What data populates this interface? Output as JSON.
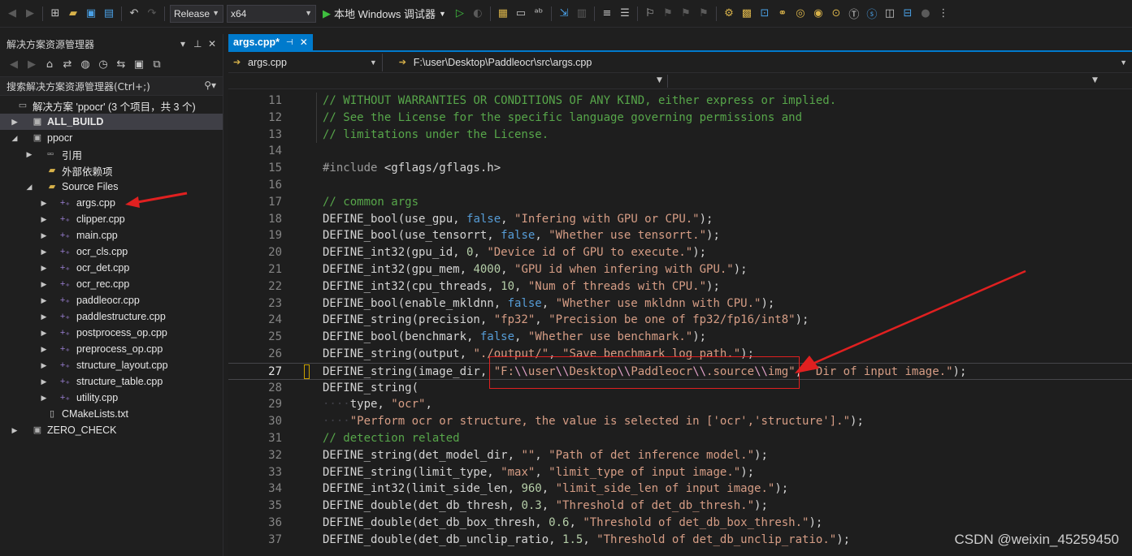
{
  "toolbar": {
    "configuration": "Release",
    "platform": "x64",
    "run_label": "本地 Windows 调试器"
  },
  "explorer": {
    "title": "解决方案资源管理器",
    "search_placeholder": "搜索解决方案资源管理器(Ctrl+;)",
    "items": [
      {
        "label": "解决方案 'ppocr' (3 个项目，共 3 个)",
        "icon": "solution-icon"
      },
      {
        "label": "ALL_BUILD",
        "icon": "project-icon"
      },
      {
        "label": "ppocr",
        "icon": "project-icon"
      },
      {
        "label": "引用",
        "icon": "references-icon"
      },
      {
        "label": "外部依赖项",
        "icon": "folder-icon"
      },
      {
        "label": "Source Files",
        "icon": "folder-icon"
      },
      {
        "label": "args.cpp",
        "icon": "cpp-file-icon"
      },
      {
        "label": "clipper.cpp",
        "icon": "cpp-file-icon"
      },
      {
        "label": "main.cpp",
        "icon": "cpp-file-icon"
      },
      {
        "label": "ocr_cls.cpp",
        "icon": "cpp-file-icon"
      },
      {
        "label": "ocr_det.cpp",
        "icon": "cpp-file-icon"
      },
      {
        "label": "ocr_rec.cpp",
        "icon": "cpp-file-icon"
      },
      {
        "label": "paddleocr.cpp",
        "icon": "cpp-file-icon"
      },
      {
        "label": "paddlestructure.cpp",
        "icon": "cpp-file-icon"
      },
      {
        "label": "postprocess_op.cpp",
        "icon": "cpp-file-icon"
      },
      {
        "label": "preprocess_op.cpp",
        "icon": "cpp-file-icon"
      },
      {
        "label": "structure_layout.cpp",
        "icon": "cpp-file-icon"
      },
      {
        "label": "structure_table.cpp",
        "icon": "cpp-file-icon"
      },
      {
        "label": "utility.cpp",
        "icon": "cpp-file-icon"
      },
      {
        "label": "CMakeLists.txt",
        "icon": "text-file-icon"
      },
      {
        "label": "ZERO_CHECK",
        "icon": "project-icon"
      }
    ]
  },
  "editor": {
    "tab_label": "args.cpp*",
    "nav_file": "args.cpp",
    "nav_path": "F:\\user\\Desktop\\Paddleocr\\src\\args.cpp",
    "current_line": "27",
    "lines": [
      {
        "n": "11",
        "tokens": [
          [
            "c-cm",
            "// WITHOUT WARRANTIES OR CONDITIONS OF ANY KIND, either express or implied."
          ]
        ]
      },
      {
        "n": "12",
        "tokens": [
          [
            "c-cm",
            "// See the License for the specific language governing permissions and"
          ]
        ]
      },
      {
        "n": "13",
        "tokens": [
          [
            "c-cm",
            "// limitations under the License."
          ]
        ]
      },
      {
        "n": "14",
        "tokens": []
      },
      {
        "n": "15",
        "tokens": [
          [
            "c-pp",
            "#include "
          ],
          [
            "",
            "<gflags/gflags.h>"
          ]
        ]
      },
      {
        "n": "16",
        "tokens": []
      },
      {
        "n": "17",
        "tokens": [
          [
            "c-cm",
            "// common args"
          ]
        ]
      },
      {
        "n": "18",
        "tokens": [
          [
            "",
            "DEFINE_bool(use_gpu, "
          ],
          [
            "c-kw",
            "false"
          ],
          [
            "",
            ", "
          ],
          [
            "c-st",
            "\"Infering with GPU or CPU.\""
          ],
          [
            "",
            ");"
          ]
        ]
      },
      {
        "n": "19",
        "tokens": [
          [
            "",
            "DEFINE_bool(use_tensorrt, "
          ],
          [
            "c-kw",
            "false"
          ],
          [
            "",
            ", "
          ],
          [
            "c-st",
            "\"Whether use tensorrt.\""
          ],
          [
            "",
            ");"
          ]
        ]
      },
      {
        "n": "20",
        "tokens": [
          [
            "",
            "DEFINE_int32(gpu_id, "
          ],
          [
            "c-nm",
            "0"
          ],
          [
            "",
            ", "
          ],
          [
            "c-st",
            "\"Device id of GPU to execute.\""
          ],
          [
            "",
            ");"
          ]
        ]
      },
      {
        "n": "21",
        "tokens": [
          [
            "",
            "DEFINE_int32(gpu_mem, "
          ],
          [
            "c-nm",
            "4000"
          ],
          [
            "",
            ", "
          ],
          [
            "c-st",
            "\"GPU id when infering with GPU.\""
          ],
          [
            "",
            ");"
          ]
        ]
      },
      {
        "n": "22",
        "tokens": [
          [
            "",
            "DEFINE_int32(cpu_threads, "
          ],
          [
            "c-nm",
            "10"
          ],
          [
            "",
            ", "
          ],
          [
            "c-st",
            "\"Num of threads with CPU.\""
          ],
          [
            "",
            ");"
          ]
        ]
      },
      {
        "n": "23",
        "tokens": [
          [
            "",
            "DEFINE_bool(enable_mkldnn, "
          ],
          [
            "c-kw",
            "false"
          ],
          [
            "",
            ", "
          ],
          [
            "c-st",
            "\"Whether use mkldnn with CPU.\""
          ],
          [
            "",
            ");"
          ]
        ]
      },
      {
        "n": "24",
        "tokens": [
          [
            "",
            "DEFINE_string(precision, "
          ],
          [
            "c-st",
            "\"fp32\""
          ],
          [
            "",
            ", "
          ],
          [
            "c-st",
            "\"Precision be one of fp32/fp16/int8\""
          ],
          [
            "",
            ");"
          ]
        ]
      },
      {
        "n": "25",
        "tokens": [
          [
            "",
            "DEFINE_bool(benchmark, "
          ],
          [
            "c-kw",
            "false"
          ],
          [
            "",
            ", "
          ],
          [
            "c-st",
            "\"Whether use benchmark.\""
          ],
          [
            "",
            ");"
          ]
        ]
      },
      {
        "n": "26",
        "tokens": [
          [
            "",
            "DEFINE_string(output, "
          ],
          [
            "c-st",
            "\"./output/\""
          ],
          [
            "",
            ", "
          ],
          [
            "c-st",
            "\"Save benchmark log path.\""
          ],
          [
            "",
            ");"
          ]
        ]
      },
      {
        "n": "27",
        "tokens": [
          [
            "",
            "DEFINE_string(image_dir, "
          ],
          [
            "c-st",
            "\"F:"
          ],
          [
            "c-es",
            "\\\\"
          ],
          [
            "c-st",
            "user"
          ],
          [
            "c-es",
            "\\\\"
          ],
          [
            "c-st",
            "Desktop"
          ],
          [
            "c-es",
            "\\\\"
          ],
          [
            "c-st",
            "Paddleocr"
          ],
          [
            "c-es",
            "\\\\"
          ],
          [
            "c-st",
            ".source"
          ],
          [
            "c-es",
            "\\\\"
          ],
          [
            "c-st",
            "img\""
          ],
          [
            "",
            ", "
          ],
          [
            "c-st",
            "\"Dir of input image.\""
          ],
          [
            "",
            ");"
          ]
        ]
      },
      {
        "n": "28",
        "tokens": [
          [
            "",
            "DEFINE_string("
          ]
        ]
      },
      {
        "n": "29",
        "tokens": [
          [
            "c-ws",
            "····"
          ],
          [
            "",
            "type, "
          ],
          [
            "c-st",
            "\"ocr\""
          ],
          [
            "",
            ","
          ]
        ]
      },
      {
        "n": "30",
        "tokens": [
          [
            "c-ws",
            "····"
          ],
          [
            "c-st",
            "\"Perform ocr or structure, the value is selected in ['ocr','structure'].\""
          ],
          [
            "",
            ");"
          ]
        ]
      },
      {
        "n": "31",
        "tokens": [
          [
            "c-cm",
            "// detection related"
          ]
        ]
      },
      {
        "n": "32",
        "tokens": [
          [
            "",
            "DEFINE_string(det_model_dir, "
          ],
          [
            "c-st",
            "\"\""
          ],
          [
            "",
            ", "
          ],
          [
            "c-st",
            "\"Path of det inference model.\""
          ],
          [
            "",
            ");"
          ]
        ]
      },
      {
        "n": "33",
        "tokens": [
          [
            "",
            "DEFINE_string(limit_type, "
          ],
          [
            "c-st",
            "\"max\""
          ],
          [
            "",
            ", "
          ],
          [
            "c-st",
            "\"limit_type of input image.\""
          ],
          [
            "",
            ");"
          ]
        ]
      },
      {
        "n": "34",
        "tokens": [
          [
            "",
            "DEFINE_int32(limit_side_len, "
          ],
          [
            "c-nm",
            "960"
          ],
          [
            "",
            ", "
          ],
          [
            "c-st",
            "\"limit_side_len of input image.\""
          ],
          [
            "",
            ");"
          ]
        ]
      },
      {
        "n": "35",
        "tokens": [
          [
            "",
            "DEFINE_double(det_db_thresh, "
          ],
          [
            "c-nm",
            "0.3"
          ],
          [
            "",
            ", "
          ],
          [
            "c-st",
            "\"Threshold of det_db_thresh.\""
          ],
          [
            "",
            ");"
          ]
        ]
      },
      {
        "n": "36",
        "tokens": [
          [
            "",
            "DEFINE_double(det_db_box_thresh, "
          ],
          [
            "c-nm",
            "0.6"
          ],
          [
            "",
            ", "
          ],
          [
            "c-st",
            "\"Threshold of det_db_box_thresh.\""
          ],
          [
            "",
            ");"
          ]
        ]
      },
      {
        "n": "37",
        "tokens": [
          [
            "",
            "DEFINE_double(det_db_unclip_ratio, "
          ],
          [
            "c-nm",
            "1.5"
          ],
          [
            "",
            ", "
          ],
          [
            "c-st",
            "\"Threshold of det_db_unclip_ratio.\""
          ],
          [
            "",
            ");"
          ]
        ]
      }
    ]
  },
  "watermark": "CSDN @weixin_45259450",
  "colors": {
    "accent": "#007acc",
    "annotation": "#e02020"
  }
}
